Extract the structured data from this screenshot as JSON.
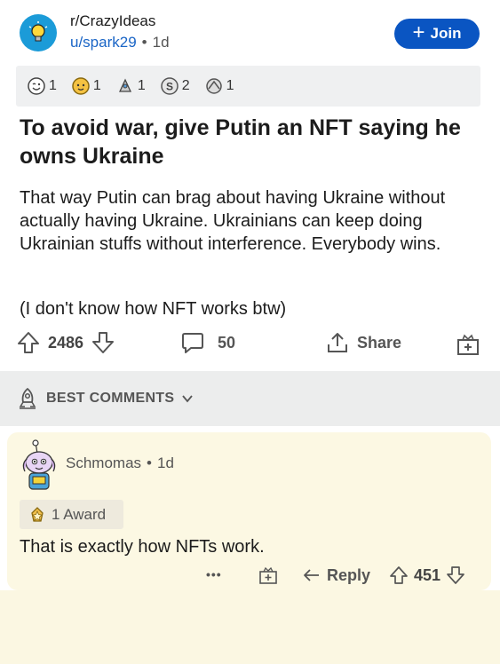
{
  "post": {
    "subreddit": "r/CrazyIdeas",
    "user": "u/spark29",
    "separator": "•",
    "age": "1d",
    "join_label": "Join",
    "awards": [
      {
        "icon": "wink-award-icon",
        "count": "1"
      },
      {
        "icon": "wholesome-award-icon",
        "count": "1"
      },
      {
        "icon": "rocket-award-icon",
        "count": "1"
      },
      {
        "icon": "silver-award-icon",
        "count": "2"
      },
      {
        "icon": "helpful-award-icon",
        "count": "1"
      }
    ],
    "title": "To avoid war, give Putin an NFT saying he owns Ukraine",
    "body": "That way Putin can brag about having Ukraine without actually having Ukraine. Ukrainians can keep doing Ukrainian stuffs without interference. Everybody wins.",
    "note": "(I don't know how NFT works btw)",
    "votes": "2486",
    "comments": "50",
    "share_label": "Share"
  },
  "sort": {
    "label": "BEST COMMENTS"
  },
  "comment": {
    "user": "Schmomas",
    "separator": "•",
    "age": "1d",
    "award_label": "1 Award",
    "text": "That is exactly how NFTs work.",
    "more": "•••",
    "reply_label": "Reply",
    "votes": "451"
  },
  "colors": {
    "join_bg": "#0a55c2",
    "link": "#1a65c6",
    "comment_bg": "#fcf8e3"
  }
}
